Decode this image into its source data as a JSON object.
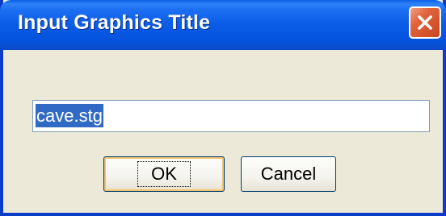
{
  "window": {
    "title": "Input Graphics Title"
  },
  "dialog": {
    "input_value": "cave.stg",
    "ok_label": "OK",
    "cancel_label": "Cancel"
  },
  "icons": {
    "close": "close-icon"
  },
  "colors": {
    "titlebar": "#0a5ce6",
    "close_button": "#e0643c",
    "background": "#ece9d8",
    "selection": "#316ac5",
    "button_border": "#003c74"
  }
}
